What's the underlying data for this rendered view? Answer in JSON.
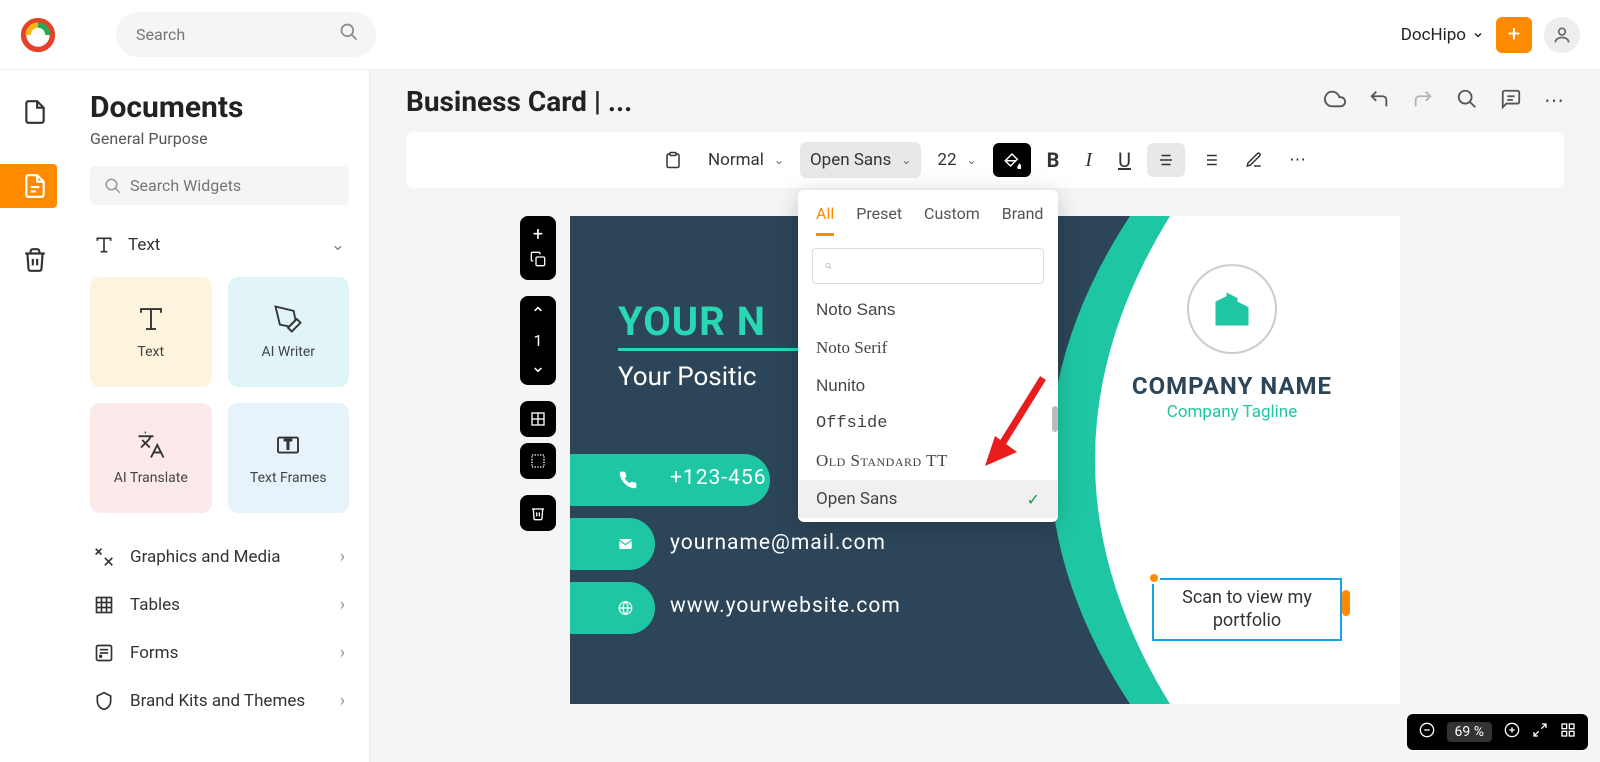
{
  "topbar": {
    "search_placeholder": "Search",
    "workspace": "DocHipo"
  },
  "sidepanel": {
    "title": "Documents",
    "subtitle": "General Purpose",
    "widget_search_placeholder": "Search Widgets",
    "section_text": "Text",
    "widgets": {
      "text": "Text",
      "ai_writer": "AI Writer",
      "ai_translate": "AI Translate",
      "text_frames": "Text Frames"
    },
    "categories": [
      "Graphics and Media",
      "Tables",
      "Forms",
      "Brand Kits and Themes"
    ]
  },
  "main": {
    "title": "Business Card | ..."
  },
  "toolbar": {
    "style": "Normal",
    "font": "Open Sans",
    "size": "22"
  },
  "page_nav": {
    "current": "1"
  },
  "card": {
    "name": "YOUR N",
    "position": "Your Positic",
    "phone": "+123-456",
    "email": "yourname@mail.com",
    "web": "www.yourwebsite.com",
    "company": "COMPANY NAME",
    "tagline": "Company Tagline",
    "scan_text": "Scan to view my portfolio"
  },
  "font_dropdown": {
    "tabs": [
      "All",
      "Preset",
      "Custom",
      "Brand"
    ],
    "active_tab": "All",
    "items": [
      {
        "label": "Noto Sans",
        "cls": "notosans"
      },
      {
        "label": "Noto Serif",
        "cls": "notoserif"
      },
      {
        "label": "Nunito",
        "cls": "nunito"
      },
      {
        "label": "Offside",
        "cls": "offside"
      },
      {
        "label": "Old Standard TT",
        "cls": "oldstd"
      },
      {
        "label": "Open Sans",
        "cls": "opensans",
        "selected": true
      }
    ]
  },
  "zoom": {
    "pct": "69 %"
  }
}
